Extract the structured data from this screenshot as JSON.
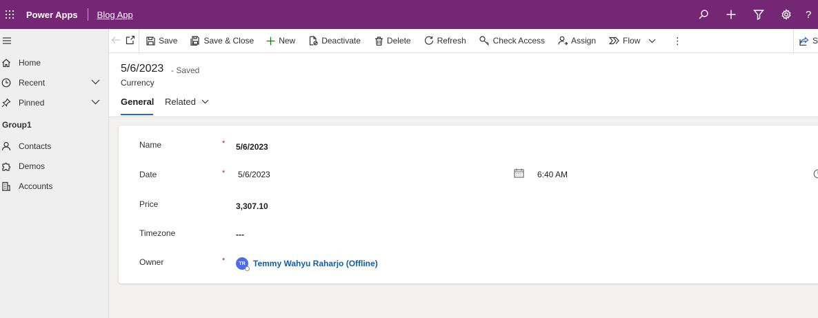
{
  "topbar": {
    "app_name": "Power Apps",
    "app_link": "Blog App",
    "accent": "#742774",
    "icons": [
      "search-icon",
      "plus-icon",
      "filter-icon",
      "gear-icon",
      "help-icon"
    ],
    "help_label": "?"
  },
  "sidebar": {
    "items": [
      {
        "label": "Home",
        "icon": "home-icon"
      },
      {
        "label": "Recent",
        "icon": "clock-icon"
      },
      {
        "label": "Pinned",
        "icon": "pin-icon"
      }
    ],
    "group_label": "Group1",
    "group_items": [
      {
        "label": "Contacts",
        "icon": "person-icon"
      },
      {
        "label": "Demos",
        "icon": "puzzle-icon"
      },
      {
        "label": "Accounts",
        "icon": "building-icon"
      }
    ]
  },
  "commands": {
    "save": "Save",
    "save_close": "Save & Close",
    "new": "New",
    "deactivate": "Deactivate",
    "delete": "Delete",
    "refresh": "Refresh",
    "check_access": "Check Access",
    "assign": "Assign",
    "flow": "Flow",
    "more": "⋮",
    "share": "S"
  },
  "record": {
    "title": "5/6/2023",
    "status": "- Saved",
    "entity": "Currency",
    "tabs": {
      "general": "General",
      "related": "Related"
    }
  },
  "form": {
    "name_label": "Name",
    "name_value": "5/6/2023",
    "date_label": "Date",
    "date_value": "5/6/2023",
    "time_value": "6:40 AM",
    "price_label": "Price",
    "price_value": "3,307.10",
    "timezone_label": "Timezone",
    "timezone_value": "---",
    "owner_label": "Owner",
    "owner_initials": "TR",
    "owner_name": "Temmy Wahyu Raharjo (Offline)",
    "required_mark": "*"
  }
}
